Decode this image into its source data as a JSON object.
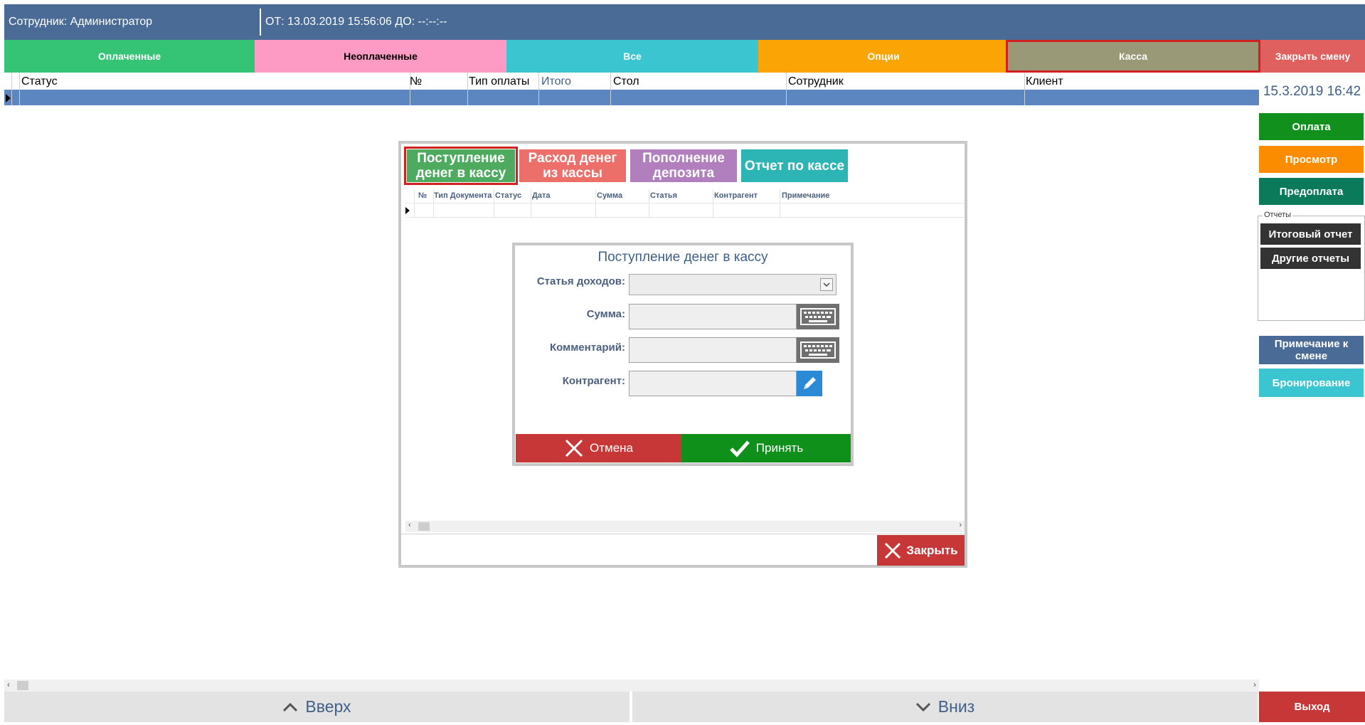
{
  "topbar": {
    "employee": "Сотрудник: Администратор",
    "period": "ОТ: 13.03.2019 15:56:06 ДО: --:--:--"
  },
  "tabs": [
    {
      "label": "Оплаченные",
      "color": "#35c375"
    },
    {
      "label": "Неоплаченные",
      "color": "#fd9bc4"
    },
    {
      "label": "Все",
      "color": "#3bc5d0"
    },
    {
      "label": "Опции",
      "color": "#fba406"
    },
    {
      "label": "Касса",
      "color": "#999977"
    },
    {
      "label": "Закрыть смену",
      "color": "#e06060"
    }
  ],
  "grid": {
    "columns": [
      "Статус",
      "№",
      "Тип оплаты",
      "Итого",
      "Стол",
      "Сотрудник",
      "Клиент"
    ]
  },
  "side": {
    "datetime": "15.3.2019 16:42",
    "pay": "Оплата",
    "view": "Просмотр",
    "prepay": "Предоплата",
    "reports_group": "Отчеты",
    "summary_report": "Итоговый отчет",
    "other_reports": "Другие отчеты",
    "shift_note": "Примечание к смене",
    "booking": "Бронирование"
  },
  "bottom": {
    "up": "Вверх",
    "down": "Вниз",
    "exit": "Выход"
  },
  "cash_dialog": {
    "tabs": [
      {
        "label": "Поступление денег в кассу",
        "color": "#4daa5e"
      },
      {
        "label": "Расход денег из кассы",
        "color": "#ec6f6a"
      },
      {
        "label": "Пополнение депозита",
        "color": "#b17fbd"
      },
      {
        "label": "Отчет по кассе",
        "color": "#2db5b5"
      }
    ],
    "columns": [
      "№",
      "Тип Документа",
      "Статус",
      "Дата",
      "Сумма",
      "Статья",
      "Контрагент",
      "Примечание"
    ],
    "close": "Закрыть"
  },
  "income_form": {
    "title": "Поступление денег в кассу",
    "article_label": "Статья доходов:",
    "article_value": "",
    "amount_label": "Сумма:",
    "amount_value": "",
    "comment_label": "Комментарий:",
    "comment_value": "",
    "contractor_label": "Контрагент:",
    "contractor_value": "",
    "cancel": "Отмена",
    "accept": "Принять"
  }
}
